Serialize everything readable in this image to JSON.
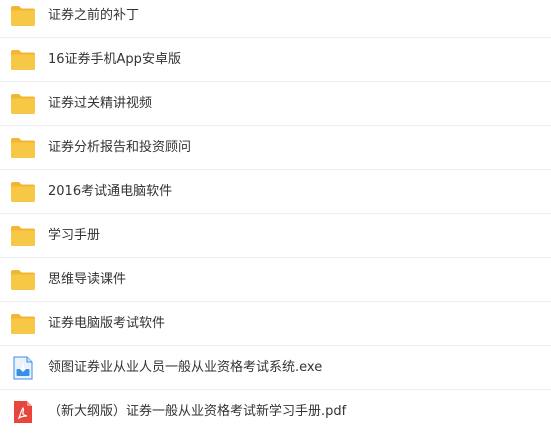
{
  "files": [
    {
      "name": "证券之前的补丁",
      "icon": "folder-icon",
      "type": "folder"
    },
    {
      "name": "16证券手机App安卓版",
      "icon": "folder-icon",
      "type": "folder"
    },
    {
      "name": "证券过关精讲视频",
      "icon": "folder-icon",
      "type": "folder"
    },
    {
      "name": "证券分析报告和投资顾问",
      "icon": "folder-icon",
      "type": "folder"
    },
    {
      "name": "2016考试通电脑软件",
      "icon": "folder-icon",
      "type": "folder"
    },
    {
      "name": "学习手册",
      "icon": "folder-icon",
      "type": "folder"
    },
    {
      "name": "思维导读课件",
      "icon": "folder-icon",
      "type": "folder"
    },
    {
      "name": "证券电脑版考试软件",
      "icon": "folder-icon",
      "type": "folder"
    },
    {
      "name": "领图证券业从业人员一般从业资格考试系统.exe",
      "icon": "exe-file-icon",
      "type": "exe"
    },
    {
      "name": "（新大纲版）证券一般从业资格考试新学习手册.pdf",
      "icon": "pdf-file-icon",
      "type": "pdf"
    }
  ],
  "colors": {
    "folder": "#f7c846",
    "folder_tab": "#f2b632",
    "exe": "#3a8ee6",
    "pdf": "#e8453c",
    "text": "#333333",
    "divider": "#eef0f3"
  }
}
